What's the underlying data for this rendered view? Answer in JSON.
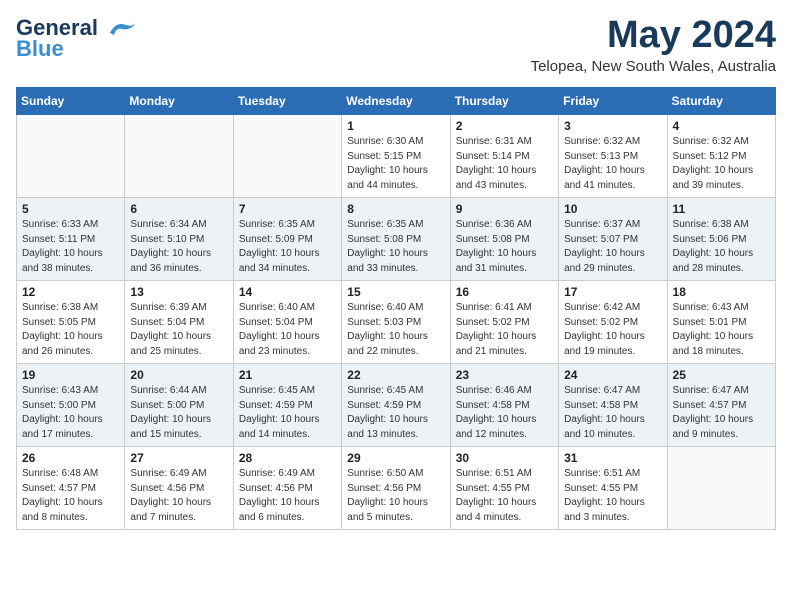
{
  "header": {
    "logo_line1": "General",
    "logo_line2": "Blue",
    "month_title": "May 2024",
    "location": "Telopea, New South Wales, Australia"
  },
  "calendar": {
    "days_of_week": [
      "Sunday",
      "Monday",
      "Tuesday",
      "Wednesday",
      "Thursday",
      "Friday",
      "Saturday"
    ],
    "weeks": [
      [
        {
          "day": "",
          "info": ""
        },
        {
          "day": "",
          "info": ""
        },
        {
          "day": "",
          "info": ""
        },
        {
          "day": "1",
          "info": "Sunrise: 6:30 AM\nSunset: 5:15 PM\nDaylight: 10 hours\nand 44 minutes."
        },
        {
          "day": "2",
          "info": "Sunrise: 6:31 AM\nSunset: 5:14 PM\nDaylight: 10 hours\nand 43 minutes."
        },
        {
          "day": "3",
          "info": "Sunrise: 6:32 AM\nSunset: 5:13 PM\nDaylight: 10 hours\nand 41 minutes."
        },
        {
          "day": "4",
          "info": "Sunrise: 6:32 AM\nSunset: 5:12 PM\nDaylight: 10 hours\nand 39 minutes."
        }
      ],
      [
        {
          "day": "5",
          "info": "Sunrise: 6:33 AM\nSunset: 5:11 PM\nDaylight: 10 hours\nand 38 minutes."
        },
        {
          "day": "6",
          "info": "Sunrise: 6:34 AM\nSunset: 5:10 PM\nDaylight: 10 hours\nand 36 minutes."
        },
        {
          "day": "7",
          "info": "Sunrise: 6:35 AM\nSunset: 5:09 PM\nDaylight: 10 hours\nand 34 minutes."
        },
        {
          "day": "8",
          "info": "Sunrise: 6:35 AM\nSunset: 5:08 PM\nDaylight: 10 hours\nand 33 minutes."
        },
        {
          "day": "9",
          "info": "Sunrise: 6:36 AM\nSunset: 5:08 PM\nDaylight: 10 hours\nand 31 minutes."
        },
        {
          "day": "10",
          "info": "Sunrise: 6:37 AM\nSunset: 5:07 PM\nDaylight: 10 hours\nand 29 minutes."
        },
        {
          "day": "11",
          "info": "Sunrise: 6:38 AM\nSunset: 5:06 PM\nDaylight: 10 hours\nand 28 minutes."
        }
      ],
      [
        {
          "day": "12",
          "info": "Sunrise: 6:38 AM\nSunset: 5:05 PM\nDaylight: 10 hours\nand 26 minutes."
        },
        {
          "day": "13",
          "info": "Sunrise: 6:39 AM\nSunset: 5:04 PM\nDaylight: 10 hours\nand 25 minutes."
        },
        {
          "day": "14",
          "info": "Sunrise: 6:40 AM\nSunset: 5:04 PM\nDaylight: 10 hours\nand 23 minutes."
        },
        {
          "day": "15",
          "info": "Sunrise: 6:40 AM\nSunset: 5:03 PM\nDaylight: 10 hours\nand 22 minutes."
        },
        {
          "day": "16",
          "info": "Sunrise: 6:41 AM\nSunset: 5:02 PM\nDaylight: 10 hours\nand 21 minutes."
        },
        {
          "day": "17",
          "info": "Sunrise: 6:42 AM\nSunset: 5:02 PM\nDaylight: 10 hours\nand 19 minutes."
        },
        {
          "day": "18",
          "info": "Sunrise: 6:43 AM\nSunset: 5:01 PM\nDaylight: 10 hours\nand 18 minutes."
        }
      ],
      [
        {
          "day": "19",
          "info": "Sunrise: 6:43 AM\nSunset: 5:00 PM\nDaylight: 10 hours\nand 17 minutes."
        },
        {
          "day": "20",
          "info": "Sunrise: 6:44 AM\nSunset: 5:00 PM\nDaylight: 10 hours\nand 15 minutes."
        },
        {
          "day": "21",
          "info": "Sunrise: 6:45 AM\nSunset: 4:59 PM\nDaylight: 10 hours\nand 14 minutes."
        },
        {
          "day": "22",
          "info": "Sunrise: 6:45 AM\nSunset: 4:59 PM\nDaylight: 10 hours\nand 13 minutes."
        },
        {
          "day": "23",
          "info": "Sunrise: 6:46 AM\nSunset: 4:58 PM\nDaylight: 10 hours\nand 12 minutes."
        },
        {
          "day": "24",
          "info": "Sunrise: 6:47 AM\nSunset: 4:58 PM\nDaylight: 10 hours\nand 10 minutes."
        },
        {
          "day": "25",
          "info": "Sunrise: 6:47 AM\nSunset: 4:57 PM\nDaylight: 10 hours\nand 9 minutes."
        }
      ],
      [
        {
          "day": "26",
          "info": "Sunrise: 6:48 AM\nSunset: 4:57 PM\nDaylight: 10 hours\nand 8 minutes."
        },
        {
          "day": "27",
          "info": "Sunrise: 6:49 AM\nSunset: 4:56 PM\nDaylight: 10 hours\nand 7 minutes."
        },
        {
          "day": "28",
          "info": "Sunrise: 6:49 AM\nSunset: 4:56 PM\nDaylight: 10 hours\nand 6 minutes."
        },
        {
          "day": "29",
          "info": "Sunrise: 6:50 AM\nSunset: 4:56 PM\nDaylight: 10 hours\nand 5 minutes."
        },
        {
          "day": "30",
          "info": "Sunrise: 6:51 AM\nSunset: 4:55 PM\nDaylight: 10 hours\nand 4 minutes."
        },
        {
          "day": "31",
          "info": "Sunrise: 6:51 AM\nSunset: 4:55 PM\nDaylight: 10 hours\nand 3 minutes."
        },
        {
          "day": "",
          "info": ""
        }
      ]
    ]
  }
}
